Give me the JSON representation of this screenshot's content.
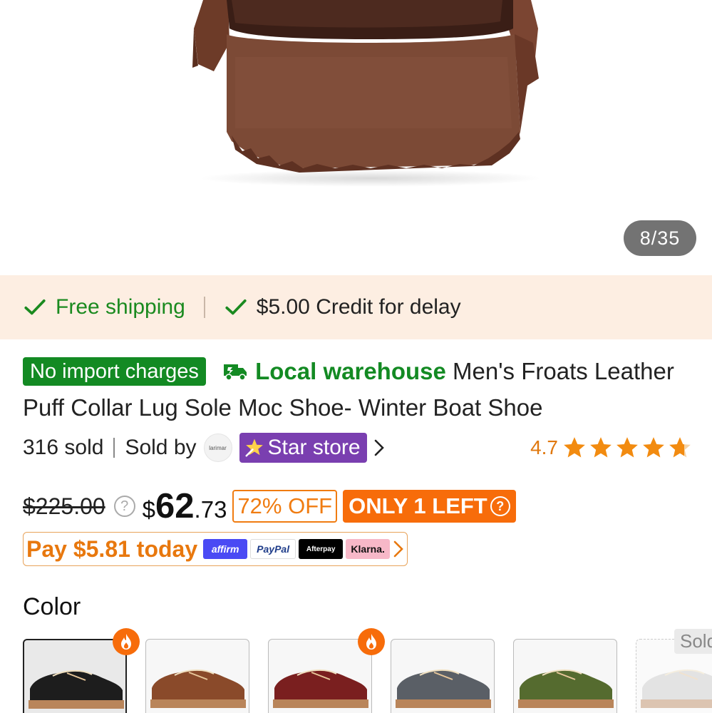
{
  "gallery": {
    "counter": "8/35"
  },
  "shipping": {
    "free_label": "Free shipping",
    "credit_label": "$5.00 Credit for delay"
  },
  "title": {
    "badge": "No import charges",
    "local": "Local warehouse",
    "text": "Men's Froats Leather Puff Collar Lug Sole Moc Shoe- Winter Boat Shoe"
  },
  "seller": {
    "sold_count": "316 sold",
    "sold_by": "Sold by",
    "logo_text": "larimar",
    "store_label": "Star store",
    "rating": "4.7"
  },
  "price": {
    "original": "$225.00",
    "currency": "$",
    "integer": "62",
    "decimal": ".73",
    "discount": "72% OFF",
    "stock": "ONLY 1 LEFT"
  },
  "pay": {
    "text": "Pay $5.81 today",
    "methods": [
      "affirm",
      "PayPal",
      "Afterpay",
      "Klarna."
    ]
  },
  "colors": {
    "label": "Color",
    "sold_tag": "Sold",
    "swatches": [
      {
        "name": "black",
        "hex": "#1d1d1d",
        "hot": true,
        "selected": true
      },
      {
        "name": "brown",
        "hex": "#8a4a2a",
        "hot": false
      },
      {
        "name": "burgundy",
        "hex": "#7a1f1f",
        "hot": true
      },
      {
        "name": "grey",
        "hex": "#5a5f66",
        "hot": false
      },
      {
        "name": "olive",
        "hex": "#556b2f",
        "hot": false
      },
      {
        "name": "light-grey",
        "hex": "#c8c8c8",
        "hot": false,
        "sold_out": true
      }
    ]
  },
  "colors_theme": {
    "green": "#138a23",
    "orange": "#f76c0a",
    "purple": "#7a3fb0",
    "ship_bg": "#fdeee2"
  }
}
